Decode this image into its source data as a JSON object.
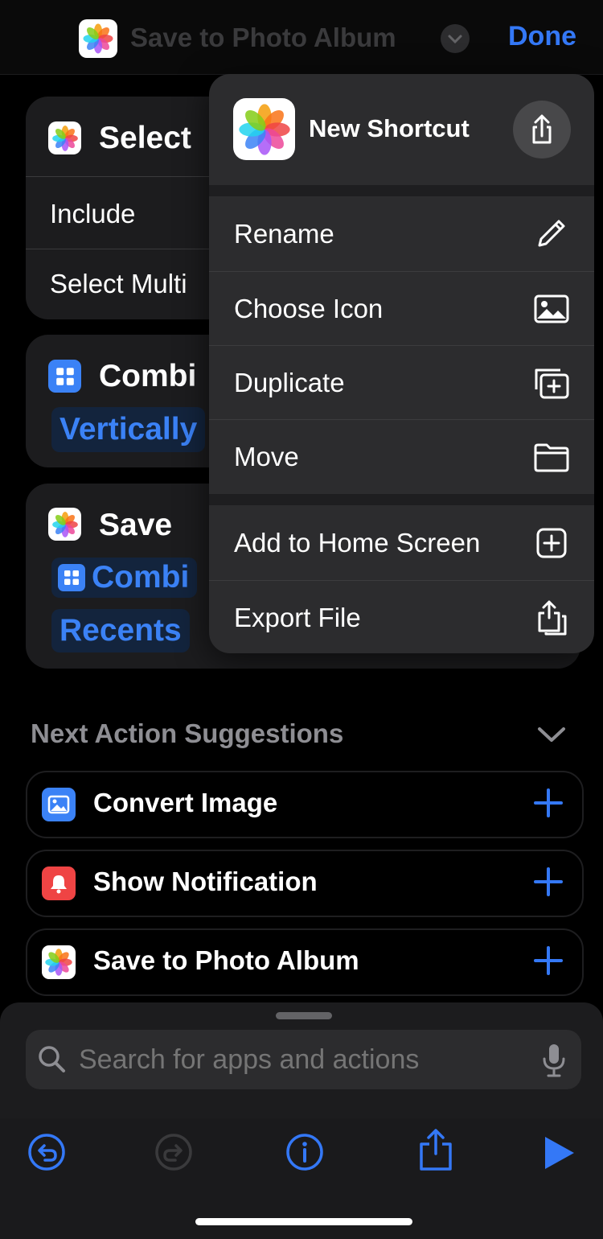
{
  "header": {
    "title": "Save to Photo Album",
    "done_label": "Done"
  },
  "actions": {
    "select_photos": {
      "title": "Select",
      "row_include": "Include",
      "row_multiple": "Select Multi"
    },
    "combine": {
      "title": "Combi",
      "token": "Vertically"
    },
    "save": {
      "title": "Save",
      "token_combine": "Combi",
      "token_album": "Recents"
    }
  },
  "menu": {
    "shortcut_name": "New Shortcut",
    "items": [
      {
        "label": "Rename",
        "icon": "pencil-icon"
      },
      {
        "label": "Choose Icon",
        "icon": "photo-icon"
      },
      {
        "label": "Duplicate",
        "icon": "duplicate-icon"
      },
      {
        "label": "Move",
        "icon": "folder-icon"
      },
      {
        "label": "Add to Home Screen",
        "icon": "add-square-icon"
      },
      {
        "label": "Export File",
        "icon": "export-file-icon"
      }
    ]
  },
  "suggestions": {
    "heading": "Next Action Suggestions",
    "items": [
      {
        "label": "Convert Image",
        "icon": "image-icon"
      },
      {
        "label": "Show Notification",
        "icon": "notification-icon"
      },
      {
        "label": "Save to Photo Album",
        "icon": "photos-icon"
      }
    ]
  },
  "search": {
    "placeholder": "Search for apps and actions"
  },
  "toolbar": {
    "icons": [
      "undo-icon",
      "redo-icon",
      "info-icon",
      "share-icon",
      "play-icon"
    ]
  },
  "colors": {
    "accent": "#3478f6",
    "background": "#000000",
    "menu": "#2c2c2e",
    "card": "#1c1c1e"
  }
}
